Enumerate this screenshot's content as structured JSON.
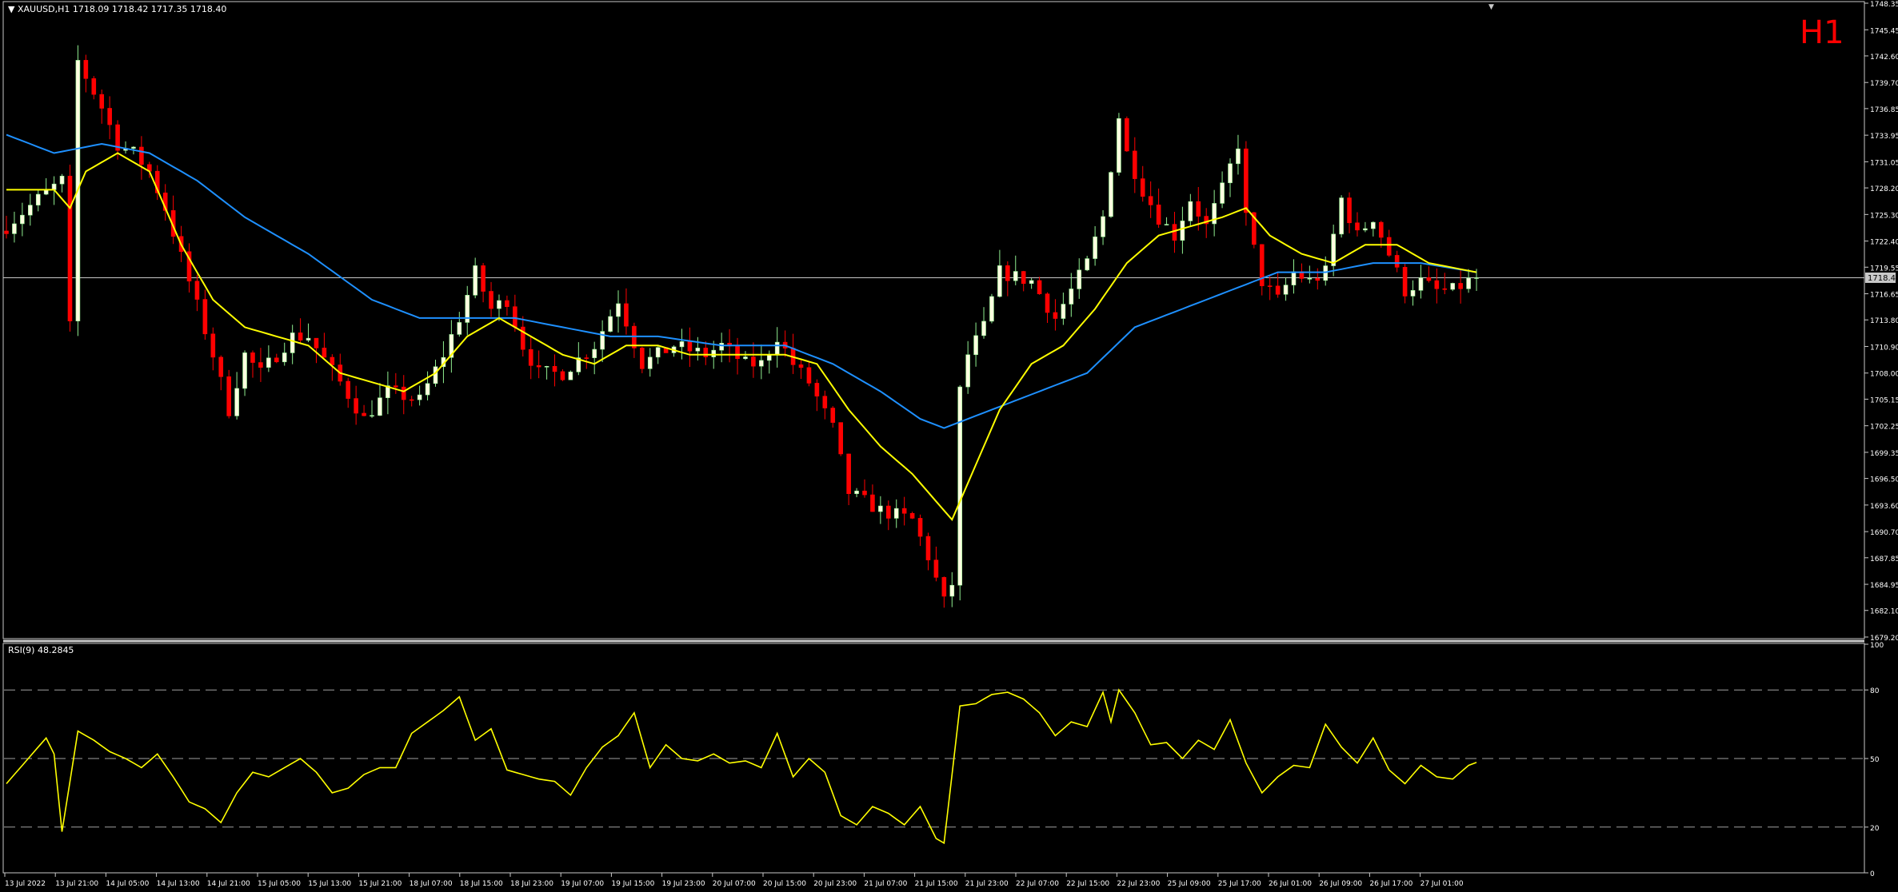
{
  "window": {
    "symbol_info": "XAUUSD,H1  1718.09 1718.42 1717.35 1718.40",
    "timeframe_label": "H1",
    "scroll_marker": "▼"
  },
  "colors": {
    "background": "#000000",
    "frame": "#c8c8c8",
    "bull_candle": "#90ee90",
    "bull_candle_body": "#ffffe0",
    "bear_candle": "#ff0000",
    "ma_fast": "#ffff00",
    "ma_slow": "#1e90ff",
    "rsi_line": "#ffff00",
    "rsi_levels": "#a0a0a0",
    "timeframe_label": "#ff0000",
    "price_line": "#c8c8c8"
  },
  "price_panel": {
    "ylim": [
      1679.2,
      1748.35
    ],
    "y_ticks": [
      "1748.35",
      "1745.45",
      "1742.60",
      "1739.70",
      "1736.85",
      "1733.95",
      "1731.05",
      "1728.20",
      "1725.30",
      "1722.40",
      "1719.55",
      "1716.65",
      "1713.80",
      "1710.90",
      "1708.00",
      "1705.15",
      "1702.25",
      "1699.35",
      "1696.50",
      "1693.60",
      "1690.70",
      "1687.85",
      "1684.95",
      "1682.10",
      "1679.20"
    ],
    "current_price": 1718.4,
    "current_price_label": "1718.40"
  },
  "rsi_panel": {
    "label": "RSI(9) 48.2845",
    "ylim": [
      0,
      100
    ],
    "levels": [
      20,
      50,
      80
    ],
    "y_ticks": [
      "100",
      "80",
      "50",
      "20",
      "0"
    ]
  },
  "x_axis": {
    "labels": [
      "13 Jul 2022",
      "13 Jul 21:00",
      "14 Jul 05:00",
      "14 Jul 13:00",
      "14 Jul 21:00",
      "15 Jul 05:00",
      "15 Jul 13:00",
      "15 Jul 21:00",
      "18 Jul 07:00",
      "18 Jul 15:00",
      "18 Jul 23:00",
      "19 Jul 07:00",
      "19 Jul 15:00",
      "19 Jul 23:00",
      "20 Jul 07:00",
      "20 Jul 15:00",
      "20 Jul 23:00",
      "21 Jul 07:00",
      "21 Jul 15:00",
      "21 Jul 23:00",
      "22 Jul 07:00",
      "22 Jul 15:00",
      "22 Jul 23:00",
      "25 Jul 09:00",
      "25 Jul 17:00",
      "26 Jul 01:00",
      "26 Jul 09:00",
      "26 Jul 17:00",
      "27 Jul 01:00"
    ]
  },
  "chart_data": {
    "type": "candlestick",
    "instrument": "XAUUSD",
    "timeframe": "H1",
    "anchors": [
      {
        "t": 0,
        "c": 1724
      },
      {
        "t": 4,
        "c": 1727
      },
      {
        "t": 7,
        "c": 1729
      },
      {
        "t": 8,
        "c": 1713
      },
      {
        "t": 9,
        "c": 1742
      },
      {
        "t": 12,
        "c": 1737
      },
      {
        "t": 14,
        "c": 1733
      },
      {
        "t": 16,
        "c": 1732
      },
      {
        "t": 18,
        "c": 1730
      },
      {
        "t": 20,
        "c": 1726
      },
      {
        "t": 23,
        "c": 1718
      },
      {
        "t": 26,
        "c": 1710
      },
      {
        "t": 28,
        "c": 1704
      },
      {
        "t": 30,
        "c": 1710
      },
      {
        "t": 32,
        "c": 1708
      },
      {
        "t": 36,
        "c": 1712
      },
      {
        "t": 38,
        "c": 1712
      },
      {
        "t": 42,
        "c": 1707
      },
      {
        "t": 45,
        "c": 1703
      },
      {
        "t": 48,
        "c": 1706
      },
      {
        "t": 52,
        "c": 1705
      },
      {
        "t": 55,
        "c": 1710
      },
      {
        "t": 57,
        "c": 1714
      },
      {
        "t": 59,
        "c": 1719
      },
      {
        "t": 61,
        "c": 1715
      },
      {
        "t": 63,
        "c": 1716
      },
      {
        "t": 65,
        "c": 1711
      },
      {
        "t": 67,
        "c": 1708
      },
      {
        "t": 70,
        "c": 1708
      },
      {
        "t": 74,
        "c": 1711
      },
      {
        "t": 77,
        "c": 1716
      },
      {
        "t": 80,
        "c": 1709
      },
      {
        "t": 84,
        "c": 1711
      },
      {
        "t": 88,
        "c": 1710
      },
      {
        "t": 90,
        "c": 1711
      },
      {
        "t": 93,
        "c": 1709
      },
      {
        "t": 95,
        "c": 1709
      },
      {
        "t": 97,
        "c": 1712
      },
      {
        "t": 99,
        "c": 1709
      },
      {
        "t": 101,
        "c": 1707
      },
      {
        "t": 104,
        "c": 1702
      },
      {
        "t": 106,
        "c": 1695
      },
      {
        "t": 110,
        "c": 1693
      },
      {
        "t": 114,
        "c": 1692
      },
      {
        "t": 116,
        "c": 1688
      },
      {
        "t": 118,
        "c": 1683
      },
      {
        "t": 119,
        "c": 1685
      },
      {
        "t": 120,
        "c": 1706
      },
      {
        "t": 121,
        "c": 1710
      },
      {
        "t": 123,
        "c": 1713
      },
      {
        "t": 125,
        "c": 1719
      },
      {
        "t": 129,
        "c": 1718
      },
      {
        "t": 132,
        "c": 1714
      },
      {
        "t": 134,
        "c": 1717
      },
      {
        "t": 136,
        "c": 1720
      },
      {
        "t": 138,
        "c": 1725
      },
      {
        "t": 140,
        "c": 1736
      },
      {
        "t": 141,
        "c": 1732
      },
      {
        "t": 143,
        "c": 1728
      },
      {
        "t": 145,
        "c": 1725
      },
      {
        "t": 147,
        "c": 1723
      },
      {
        "t": 149,
        "c": 1727
      },
      {
        "t": 151,
        "c": 1724
      },
      {
        "t": 153,
        "c": 1728
      },
      {
        "t": 155,
        "c": 1733
      },
      {
        "t": 156,
        "c": 1725
      },
      {
        "t": 158,
        "c": 1718
      },
      {
        "t": 160,
        "c": 1716
      },
      {
        "t": 162,
        "c": 1719
      },
      {
        "t": 164,
        "c": 1718
      },
      {
        "t": 166,
        "c": 1719
      },
      {
        "t": 168,
        "c": 1727
      },
      {
        "t": 170,
        "c": 1723
      },
      {
        "t": 172,
        "c": 1725
      },
      {
        "t": 174,
        "c": 1721
      },
      {
        "t": 176,
        "c": 1717
      },
      {
        "t": 178,
        "c": 1718
      },
      {
        "t": 180,
        "c": 1717
      },
      {
        "t": 182,
        "c": 1717
      },
      {
        "t": 184,
        "c": 1718
      },
      {
        "t": 185,
        "c": 1718.4
      }
    ],
    "ma_fast": [
      {
        "t": 0,
        "v": 1728
      },
      {
        "t": 6,
        "v": 1728
      },
      {
        "t": 8,
        "v": 1726
      },
      {
        "t": 10,
        "v": 1730
      },
      {
        "t": 14,
        "v": 1732
      },
      {
        "t": 18,
        "v": 1730
      },
      {
        "t": 22,
        "v": 1722
      },
      {
        "t": 26,
        "v": 1716
      },
      {
        "t": 30,
        "v": 1713
      },
      {
        "t": 34,
        "v": 1712
      },
      {
        "t": 38,
        "v": 1711
      },
      {
        "t": 42,
        "v": 1708
      },
      {
        "t": 46,
        "v": 1707
      },
      {
        "t": 50,
        "v": 1706
      },
      {
        "t": 54,
        "v": 1708
      },
      {
        "t": 58,
        "v": 1712
      },
      {
        "t": 62,
        "v": 1714
      },
      {
        "t": 66,
        "v": 1712
      },
      {
        "t": 70,
        "v": 1710
      },
      {
        "t": 74,
        "v": 1709
      },
      {
        "t": 78,
        "v": 1711
      },
      {
        "t": 82,
        "v": 1711
      },
      {
        "t": 86,
        "v": 1710
      },
      {
        "t": 90,
        "v": 1710
      },
      {
        "t": 94,
        "v": 1710
      },
      {
        "t": 98,
        "v": 1710
      },
      {
        "t": 102,
        "v": 1709
      },
      {
        "t": 106,
        "v": 1704
      },
      {
        "t": 110,
        "v": 1700
      },
      {
        "t": 114,
        "v": 1697
      },
      {
        "t": 118,
        "v": 1693
      },
      {
        "t": 119,
        "v": 1692
      },
      {
        "t": 121,
        "v": 1696
      },
      {
        "t": 125,
        "v": 1704
      },
      {
        "t": 129,
        "v": 1709
      },
      {
        "t": 133,
        "v": 1711
      },
      {
        "t": 137,
        "v": 1715
      },
      {
        "t": 141,
        "v": 1720
      },
      {
        "t": 145,
        "v": 1723
      },
      {
        "t": 149,
        "v": 1724
      },
      {
        "t": 153,
        "v": 1725
      },
      {
        "t": 156,
        "v": 1726
      },
      {
        "t": 159,
        "v": 1723
      },
      {
        "t": 163,
        "v": 1721
      },
      {
        "t": 167,
        "v": 1720
      },
      {
        "t": 171,
        "v": 1722
      },
      {
        "t": 175,
        "v": 1722
      },
      {
        "t": 179,
        "v": 1720
      },
      {
        "t": 185,
        "v": 1719
      }
    ],
    "ma_slow": [
      {
        "t": 0,
        "v": 1734
      },
      {
        "t": 6,
        "v": 1732
      },
      {
        "t": 12,
        "v": 1733
      },
      {
        "t": 18,
        "v": 1732
      },
      {
        "t": 24,
        "v": 1729
      },
      {
        "t": 30,
        "v": 1725
      },
      {
        "t": 38,
        "v": 1721
      },
      {
        "t": 46,
        "v": 1716
      },
      {
        "t": 52,
        "v": 1714
      },
      {
        "t": 58,
        "v": 1714
      },
      {
        "t": 64,
        "v": 1714
      },
      {
        "t": 70,
        "v": 1713
      },
      {
        "t": 76,
        "v": 1712
      },
      {
        "t": 82,
        "v": 1712
      },
      {
        "t": 90,
        "v": 1711
      },
      {
        "t": 98,
        "v": 1711
      },
      {
        "t": 104,
        "v": 1709
      },
      {
        "t": 110,
        "v": 1706
      },
      {
        "t": 115,
        "v": 1703
      },
      {
        "t": 118,
        "v": 1702
      },
      {
        "t": 124,
        "v": 1704
      },
      {
        "t": 130,
        "v": 1706
      },
      {
        "t": 136,
        "v": 1708
      },
      {
        "t": 142,
        "v": 1713
      },
      {
        "t": 148,
        "v": 1715
      },
      {
        "t": 154,
        "v": 1717
      },
      {
        "t": 160,
        "v": 1719
      },
      {
        "t": 166,
        "v": 1719
      },
      {
        "t": 172,
        "v": 1720
      },
      {
        "t": 178,
        "v": 1720
      },
      {
        "t": 185,
        "v": 1719
      }
    ],
    "rsi": [
      {
        "t": 0,
        "v": 39
      },
      {
        "t": 2,
        "v": 47
      },
      {
        "t": 4,
        "v": 55
      },
      {
        "t": 5,
        "v": 59
      },
      {
        "t": 6,
        "v": 52
      },
      {
        "t": 7,
        "v": 18
      },
      {
        "t": 9,
        "v": 62
      },
      {
        "t": 11,
        "v": 58
      },
      {
        "t": 13,
        "v": 53
      },
      {
        "t": 15,
        "v": 50
      },
      {
        "t": 17,
        "v": 46
      },
      {
        "t": 19,
        "v": 52
      },
      {
        "t": 21,
        "v": 42
      },
      {
        "t": 23,
        "v": 31
      },
      {
        "t": 25,
        "v": 28
      },
      {
        "t": 27,
        "v": 22
      },
      {
        "t": 29,
        "v": 35
      },
      {
        "t": 31,
        "v": 44
      },
      {
        "t": 33,
        "v": 42
      },
      {
        "t": 35,
        "v": 46
      },
      {
        "t": 37,
        "v": 50
      },
      {
        "t": 39,
        "v": 44
      },
      {
        "t": 41,
        "v": 35
      },
      {
        "t": 43,
        "v": 37
      },
      {
        "t": 45,
        "v": 43
      },
      {
        "t": 47,
        "v": 46
      },
      {
        "t": 49,
        "v": 46
      },
      {
        "t": 51,
        "v": 61
      },
      {
        "t": 53,
        "v": 66
      },
      {
        "t": 55,
        "v": 71
      },
      {
        "t": 57,
        "v": 77
      },
      {
        "t": 59,
        "v": 58
      },
      {
        "t": 61,
        "v": 63
      },
      {
        "t": 63,
        "v": 45
      },
      {
        "t": 65,
        "v": 43
      },
      {
        "t": 67,
        "v": 41
      },
      {
        "t": 69,
        "v": 40
      },
      {
        "t": 71,
        "v": 34
      },
      {
        "t": 73,
        "v": 46
      },
      {
        "t": 75,
        "v": 55
      },
      {
        "t": 77,
        "v": 60
      },
      {
        "t": 79,
        "v": 70
      },
      {
        "t": 81,
        "v": 46
      },
      {
        "t": 83,
        "v": 56
      },
      {
        "t": 85,
        "v": 50
      },
      {
        "t": 87,
        "v": 49
      },
      {
        "t": 89,
        "v": 52
      },
      {
        "t": 91,
        "v": 48
      },
      {
        "t": 93,
        "v": 49
      },
      {
        "t": 95,
        "v": 46
      },
      {
        "t": 97,
        "v": 61
      },
      {
        "t": 99,
        "v": 42
      },
      {
        "t": 101,
        "v": 50
      },
      {
        "t": 103,
        "v": 44
      },
      {
        "t": 105,
        "v": 25
      },
      {
        "t": 107,
        "v": 21
      },
      {
        "t": 109,
        "v": 29
      },
      {
        "t": 111,
        "v": 26
      },
      {
        "t": 113,
        "v": 21
      },
      {
        "t": 115,
        "v": 29
      },
      {
        "t": 117,
        "v": 15
      },
      {
        "t": 118,
        "v": 13
      },
      {
        "t": 120,
        "v": 73
      },
      {
        "t": 122,
        "v": 74
      },
      {
        "t": 124,
        "v": 78
      },
      {
        "t": 126,
        "v": 79
      },
      {
        "t": 128,
        "v": 76
      },
      {
        "t": 130,
        "v": 70
      },
      {
        "t": 132,
        "v": 60
      },
      {
        "t": 134,
        "v": 66
      },
      {
        "t": 136,
        "v": 64
      },
      {
        "t": 138,
        "v": 79
      },
      {
        "t": 139,
        "v": 66
      },
      {
        "t": 140,
        "v": 80
      },
      {
        "t": 142,
        "v": 70
      },
      {
        "t": 144,
        "v": 56
      },
      {
        "t": 146,
        "v": 57
      },
      {
        "t": 148,
        "v": 50
      },
      {
        "t": 150,
        "v": 58
      },
      {
        "t": 152,
        "v": 54
      },
      {
        "t": 154,
        "v": 67
      },
      {
        "t": 156,
        "v": 48
      },
      {
        "t": 158,
        "v": 35
      },
      {
        "t": 160,
        "v": 42
      },
      {
        "t": 162,
        "v": 47
      },
      {
        "t": 164,
        "v": 46
      },
      {
        "t": 166,
        "v": 65
      },
      {
        "t": 168,
        "v": 55
      },
      {
        "t": 170,
        "v": 48
      },
      {
        "t": 172,
        "v": 59
      },
      {
        "t": 174,
        "v": 45
      },
      {
        "t": 176,
        "v": 39
      },
      {
        "t": 178,
        "v": 47
      },
      {
        "t": 180,
        "v": 42
      },
      {
        "t": 182,
        "v": 41
      },
      {
        "t": 184,
        "v": 47
      },
      {
        "t": 185,
        "v": 48.28
      }
    ]
  }
}
